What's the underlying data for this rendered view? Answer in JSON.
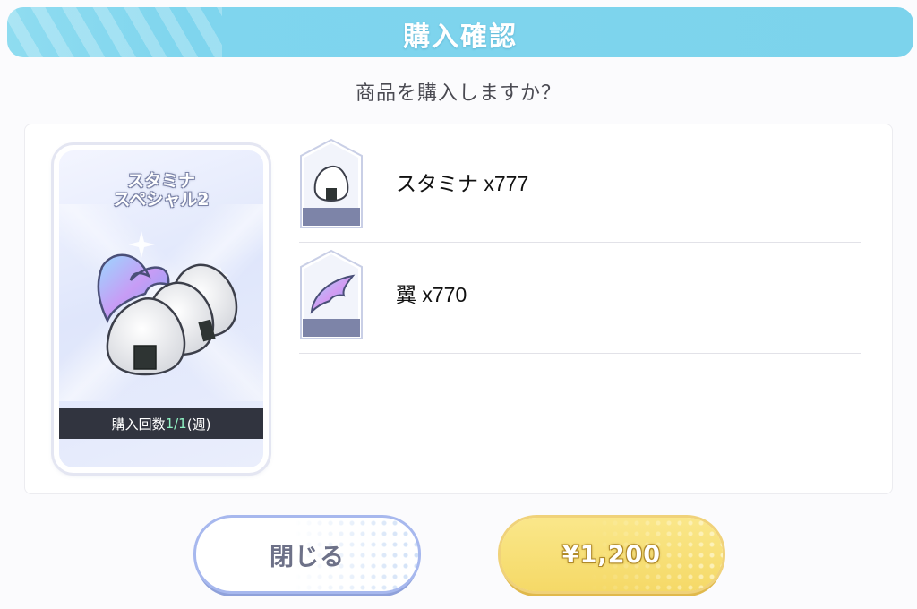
{
  "dialog": {
    "title": "購入確認",
    "question": "商品を購入しますか？"
  },
  "product": {
    "name_line1": "スタミナ",
    "name_line2": "スペシャル2",
    "limit_prefix": "購入回数",
    "limit_count": "1/1",
    "limit_suffix": "(週)",
    "art_icon": "rice-balls-and-wing-icon"
  },
  "contents": [
    {
      "icon": "rice-ball-icon",
      "label": "スタミナ x777"
    },
    {
      "icon": "wing-icon",
      "label": "翼 x770"
    }
  ],
  "buttons": {
    "close_label": "閉じる",
    "buy_label": "¥1,200"
  },
  "colors": {
    "title_bar": "#7cd3ec",
    "buy_button": "#f5d967",
    "close_button_border": "#a7b8ee",
    "limit_count": "#8ff0c2"
  }
}
